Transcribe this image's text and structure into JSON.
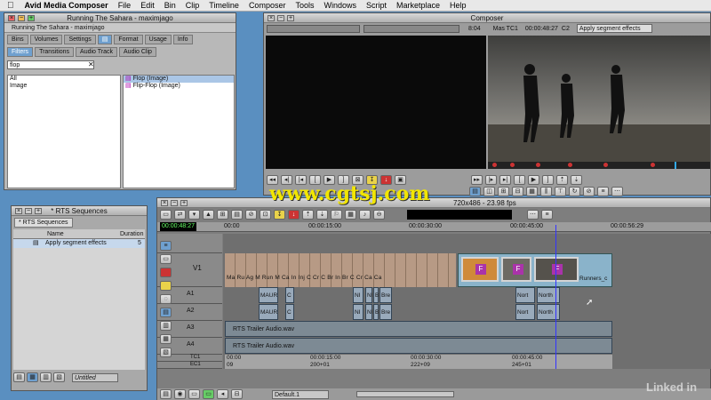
{
  "menubar": {
    "apple": "",
    "app": "Avid Media Composer",
    "items": [
      "File",
      "Edit",
      "Bin",
      "Clip",
      "Timeline",
      "Composer",
      "Tools",
      "Windows",
      "Script",
      "Marketplace",
      "Help"
    ]
  },
  "project_window": {
    "title": "Running The Sahara - maximjago",
    "subtitle": "Running The Sahara - maximjago",
    "tabs": [
      "Bins",
      "Volumes",
      "Settings",
      "",
      "Format",
      "Usage",
      "Info"
    ],
    "subtabs": [
      "Filters",
      "Transitions",
      "Audio Track",
      "Audio Clip"
    ],
    "search_value": "flop",
    "categories": [
      "All",
      "Image"
    ],
    "effects": [
      "Flop (Image)",
      "Flip-Flop (Image)"
    ]
  },
  "composer": {
    "title": "Composer",
    "timecode": "8:04",
    "mas_label": "Mas TC1",
    "timecode_value": "00:00:48:27",
    "tc_suffix": "C2",
    "mode_select": "Apply segment effects",
    "format_info": "720x486 - 23.98 fps"
  },
  "sequence_bin": {
    "title": "* RTS Sequences",
    "tab": "* RTS Sequences",
    "col_name": "Name",
    "col_duration": "Duration",
    "rows": [
      {
        "name": "Apply segment effects",
        "duration": "5"
      }
    ],
    "footer_view": "Untitled"
  },
  "timeline": {
    "timecode": "00:00:48:27",
    "ruler": [
      "00:00",
      "00:00:15:00",
      "00:00:30:00",
      "00:00:45:00",
      "00:00:56:29"
    ],
    "tracks": [
      "V1",
      "A1",
      "A2",
      "A3",
      "A4",
      "TC1",
      "EC1"
    ],
    "v1_clips": [
      "Ma",
      "Ru",
      "Ag",
      "M",
      "Run",
      "M",
      "Ca",
      "In",
      "Inj",
      "C",
      "Cr",
      "C",
      "Br",
      "In",
      "Br",
      "C",
      "Cr",
      "Ca",
      "Ca"
    ],
    "runners_clip": "Runners_c",
    "a_clips": [
      "MAUR",
      "C",
      "NI",
      "NI",
      "B",
      "Bre",
      "Nort",
      "North"
    ],
    "a2_clips": [
      "MAUR",
      "C",
      "NI",
      "NI",
      "B",
      "Bre",
      "Nort",
      "North"
    ],
    "audio_file_a3": "RTS Trailer Audio.wav",
    "audio_file_a4": "RTS Trailer Audio.wav",
    "tc_ruler": [
      "00:00",
      "00:00:15:00",
      "00:00:30:00",
      "00:00:45:00"
    ],
    "ec_ruler": [
      "09",
      "200+01",
      "222+09",
      "245+01"
    ],
    "footer_select": "Default.1"
  },
  "watermark": "www.cgtsj.com",
  "linkedin": "Linked in"
}
